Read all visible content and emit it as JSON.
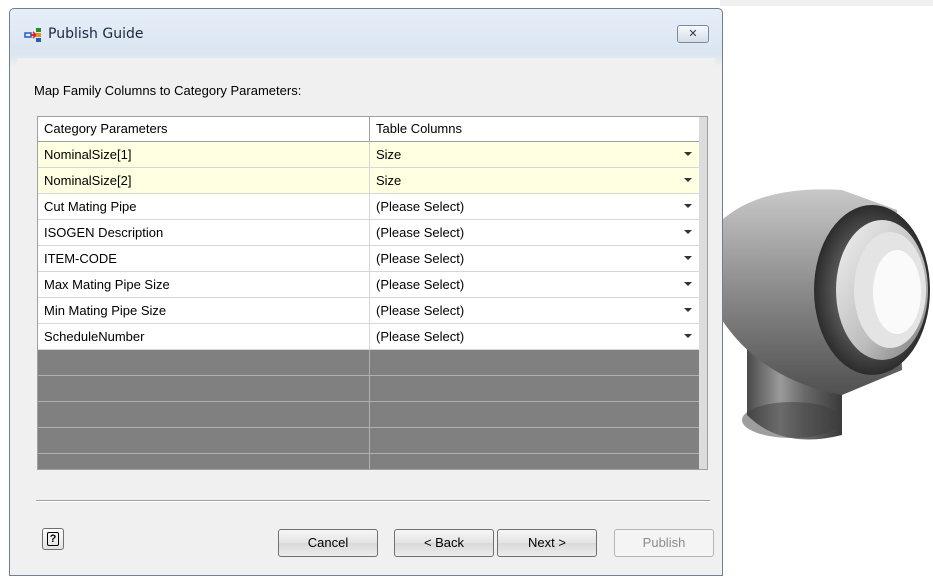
{
  "dialog": {
    "title": "Publish Guide",
    "close_label": "✕",
    "instruction": "Map Family Columns to Category Parameters:"
  },
  "grid": {
    "headers": [
      "Category Parameters",
      "Table Columns"
    ],
    "rows": [
      {
        "param": "NominalSize[1]",
        "column": "Size",
        "highlighted": true
      },
      {
        "param": "NominalSize[2]",
        "column": "Size",
        "highlighted": true
      },
      {
        "param": "Cut Mating Pipe",
        "column": "(Please Select)",
        "highlighted": false
      },
      {
        "param": "ISOGEN Description",
        "column": "(Please Select)",
        "highlighted": false
      },
      {
        "param": "ITEM-CODE",
        "column": "(Please Select)",
        "highlighted": false
      },
      {
        "param": "Max Mating Pipe Size",
        "column": "(Please Select)",
        "highlighted": false
      },
      {
        "param": "Min Mating Pipe Size",
        "column": "(Please Select)",
        "highlighted": false
      },
      {
        "param": "ScheduleNumber",
        "column": "(Please Select)",
        "highlighted": false
      }
    ]
  },
  "buttons": {
    "cancel": "Cancel",
    "back": "< Back",
    "next": "Next >",
    "publish": "Publish",
    "help": "?"
  },
  "icons": [
    "publish-guide-icon",
    "close-icon",
    "help-icon",
    "dropdown-caret-icon"
  ],
  "colors": {
    "highlight_row": "#ffffe1",
    "empty_grid": "#808080"
  }
}
